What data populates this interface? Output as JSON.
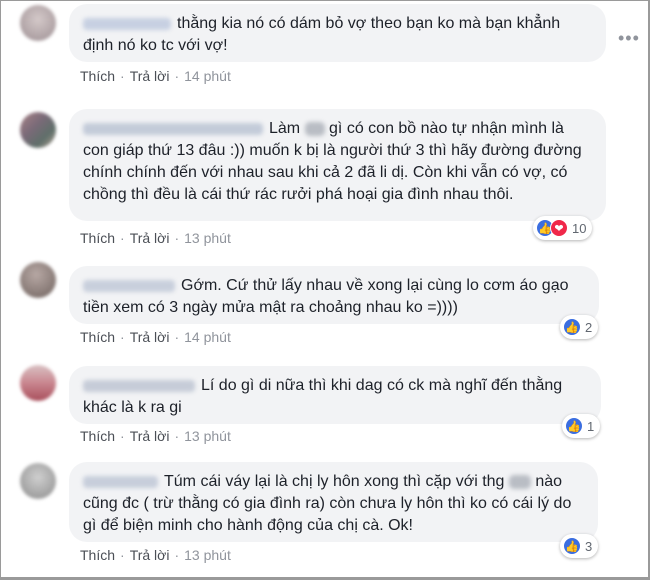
{
  "actions": {
    "like": "Thích",
    "reply": "Trả lời"
  },
  "more_icon": "•••",
  "comments": [
    {
      "text": "thằng kia nó có dám bỏ vợ theo bạn ko mà bạn khẳnh định nó ko tc với vợ!",
      "time": "14 phút"
    },
    {
      "text_a": "Làm",
      "text_b": "gì có con bồ nào tự nhận mình là con giáp thứ 13 đâu :)) muốn k bị là người thứ 3 thì hãy đường đường chính chính đến với nhau sau khi cả 2 đã li dị. Còn khi vẫn có vợ, có chồng thì đều là cái thứ rác rưởi phá hoại gia đình nhau thôi.",
      "time": "13 phút",
      "reaction_count": "10"
    },
    {
      "text": "Gớm. Cứ thử lấy nhau về xong lại cùng lo cơm áo gạo tiền xem có 3 ngày mửa mật ra choảng nhau ko =))))",
      "time": "14 phút",
      "reaction_count": "2"
    },
    {
      "text": "Lí do gì di nữa thì khi dag có ck mà nghĩ đến thằng khác là k ra gi",
      "time": "13 phút",
      "reaction_count": "1"
    },
    {
      "text_a": "Túm cái váy lại là chị ly hôn xong thì cặp với thg",
      "text_b": "nào cũng đc ( trừ thằng có gia đình ra) còn chưa ly hôn thì ko có cái lý do gì để biện minh cho hành động của chị cà. Ok!",
      "time": "13 phút",
      "reaction_count": "3"
    }
  ],
  "colors": {
    "bubble": "#f2f3f5",
    "like": "#3b6ee0",
    "love": "#f0284a",
    "link": "#4b4f56",
    "time": "#90949c"
  }
}
